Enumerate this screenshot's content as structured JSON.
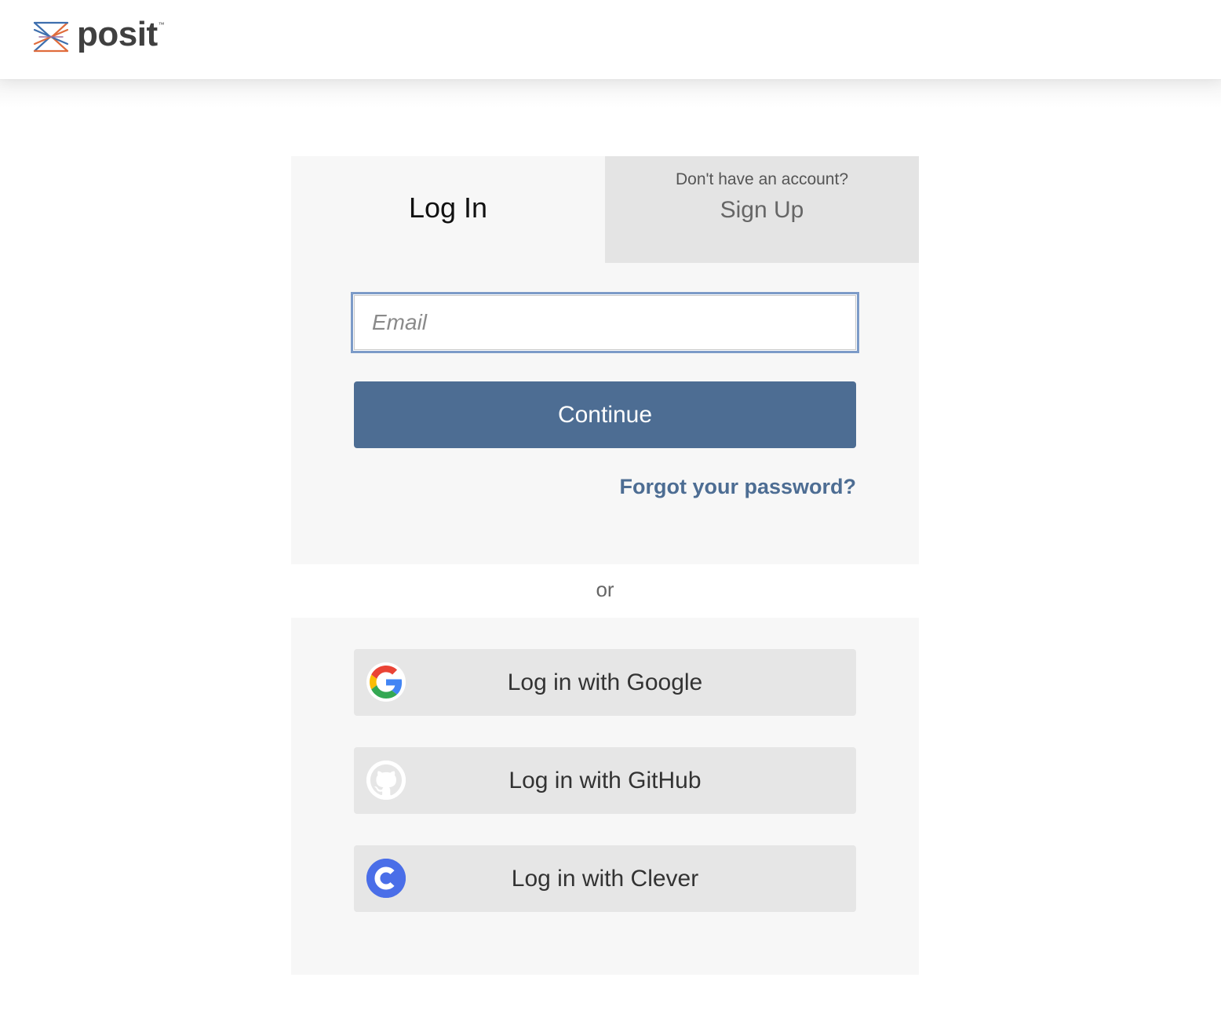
{
  "header": {
    "logo_text": "posit",
    "logo_tm": "™"
  },
  "tabs": {
    "login_label": "Log In",
    "signup_prompt": "Don't have an account?",
    "signup_label": "Sign Up"
  },
  "form": {
    "email_placeholder": "Email",
    "email_value": "",
    "continue_label": "Continue",
    "forgot_label": "Forgot your password?"
  },
  "divider": {
    "or_label": "or"
  },
  "social": {
    "google_label": "Log in with Google",
    "google_icon": "google-icon",
    "github_label": "Log in with GitHub",
    "github_icon": "github-icon",
    "clever_label": "Log in with Clever",
    "clever_icon": "clever-icon"
  },
  "colors": {
    "primary": "#4d6d93",
    "input_focus_border": "#7c9bc8",
    "card_bg": "#f7f7f7",
    "tab_inactive_bg": "#e4e4e4",
    "social_btn_bg": "#e6e6e6",
    "clever_blue": "#4a6ee8"
  }
}
